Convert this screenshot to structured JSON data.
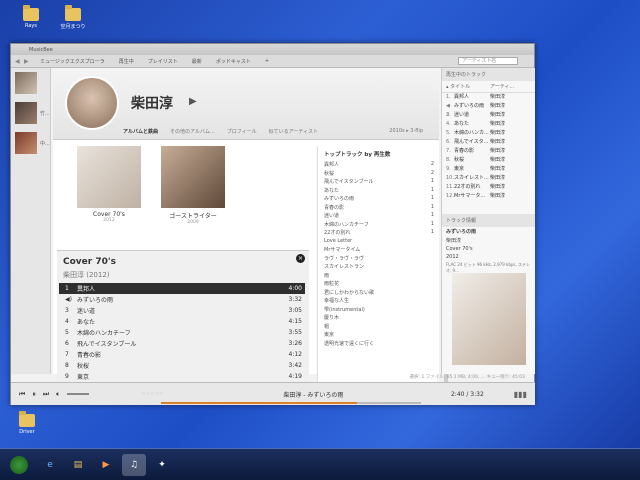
{
  "desktop": {
    "icons": [
      {
        "label": "Rays"
      },
      {
        "label": "空月まつり"
      },
      {
        "label": "Driver"
      }
    ]
  },
  "app": {
    "title": "MusicBee",
    "tabs": [
      "ミュージックエクスプローラ",
      "再生中",
      "プレイリスト",
      "最新",
      "ポッドキャスト",
      "+"
    ],
    "search_placeholder": "アーティスト名",
    "rail": [
      {
        "label": ""
      },
      {
        "label": "竹..."
      },
      {
        "label": "中..."
      }
    ]
  },
  "artist": {
    "name": "柴田淳",
    "subtabs": [
      "アルバムと鉄曲",
      "その他のアルバム...",
      "プロフィール",
      "似ているアーティスト"
    ],
    "range": "2010s ▸ 3-flip"
  },
  "albums": [
    {
      "title": "Cover 70's",
      "year": "2012"
    },
    {
      "title": "ゴーストライター",
      "year": "2009"
    }
  ],
  "album_detail": {
    "title": "Cover 70's",
    "artist_year": "柴田淳 (2012)",
    "tracks": [
      {
        "num": "1",
        "title": "異邦人",
        "duration": "4:00"
      },
      {
        "num": "◀)",
        "title": "みずいろの雨",
        "duration": "3:32"
      },
      {
        "num": "3",
        "title": "迷い道",
        "duration": "3:05"
      },
      {
        "num": "4",
        "title": "あなた",
        "duration": "4:15"
      },
      {
        "num": "5",
        "title": "木綿のハンカチーフ",
        "duration": "3:55"
      },
      {
        "num": "6",
        "title": "飛んでイスタンブール",
        "duration": "3:26"
      },
      {
        "num": "7",
        "title": "青春の影",
        "duration": "4:12"
      },
      {
        "num": "8",
        "title": "秋桜",
        "duration": "3:42"
      },
      {
        "num": "9",
        "title": "東京",
        "duration": "4:19"
      },
      {
        "num": "10",
        "title": "スカイレストラン",
        "duration": "3:36"
      }
    ]
  },
  "top_tracks": {
    "title": "トップトラック by 再生数",
    "rows": [
      {
        "title": "異邦人",
        "count": "2"
      },
      {
        "title": "秋桜",
        "count": "2"
      },
      {
        "title": "飛んでイスタンブール",
        "count": "1"
      },
      {
        "title": "あなた",
        "count": "1"
      },
      {
        "title": "みずいろの雨",
        "count": "1"
      },
      {
        "title": "青春の影",
        "count": "1"
      },
      {
        "title": "迷い道",
        "count": "1"
      },
      {
        "title": "木綿のハンカチーフ",
        "count": "1"
      },
      {
        "title": "22才の別れ",
        "count": "1"
      },
      {
        "title": "Love Letter",
        "count": ""
      },
      {
        "title": "Mrサマータイム",
        "count": ""
      },
      {
        "title": "ラヴ・ラヴ・ラヴ",
        "count": ""
      },
      {
        "title": "スカイレストラン",
        "count": ""
      },
      {
        "title": "雨",
        "count": ""
      },
      {
        "title": "雨粒花",
        "count": ""
      },
      {
        "title": "君にしかわからない歌",
        "count": ""
      },
      {
        "title": "幸福な人生",
        "count": ""
      },
      {
        "title": "雫(instrumental)",
        "count": ""
      },
      {
        "title": "慶り木",
        "count": ""
      },
      {
        "title": "帽",
        "count": ""
      },
      {
        "title": "東京",
        "count": ""
      },
      {
        "title": "透明光速で遠くに行く",
        "count": ""
      }
    ]
  },
  "queue": {
    "header": "再生中のトラック",
    "col_title": "▴ タイトル",
    "col_artist": "アーティ...",
    "rows": [
      {
        "num": "1.",
        "title": "異邦人",
        "artist": "柴田淳"
      },
      {
        "num": "◀ 2.",
        "title": "みずいろの雨",
        "artist": "柴田淳"
      },
      {
        "num": "3.",
        "title": "迷い道",
        "artist": "柴田淳"
      },
      {
        "num": "4.",
        "title": "あなた",
        "artist": "柴田淳"
      },
      {
        "num": "5.",
        "title": "木綿のハンカ...",
        "artist": "柴田淳"
      },
      {
        "num": "6.",
        "title": "飛んでイスタ...",
        "artist": "柴田淳"
      },
      {
        "num": "7.",
        "title": "青春の影",
        "artist": "柴田淳"
      },
      {
        "num": "8.",
        "title": "秋桜",
        "artist": "柴田淳"
      },
      {
        "num": "9.",
        "title": "東京",
        "artist": "柴田淳"
      },
      {
        "num": "10.",
        "title": "スカイレスト...",
        "artist": "柴田淳"
      },
      {
        "num": "11.",
        "title": "22才の別れ",
        "artist": "柴田淳"
      },
      {
        "num": "12.",
        "title": "Mrサマータ...",
        "artist": "柴田淳"
      }
    ]
  },
  "track_info": {
    "header": "トラック情報",
    "title": "みずいろの雨",
    "artist": "柴田淳",
    "album": "Cover 70's",
    "year": "2012",
    "format": "FLAC 24 ビット 96 kHz, 2,979 kbps, ステレオ, 9..."
  },
  "status": {
    "text": "選択: 1 ファイル, 85.1 MB, 4:00, ...    キュー残り: 45:03"
  },
  "player": {
    "stars": "☆☆☆☆☆",
    "now_playing": "柴田淳 - みずいろの雨",
    "time": "2:40 / 3:32",
    "progress_fraction": 0.755
  },
  "taskbar": {
    "apps": [
      "e",
      "▤",
      "▶",
      "♫",
      "✦"
    ]
  }
}
